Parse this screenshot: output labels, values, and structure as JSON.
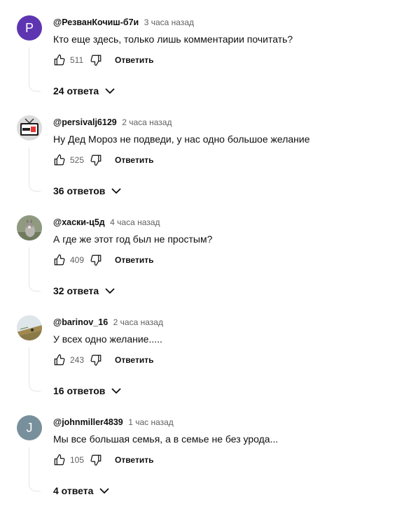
{
  "comments": [
    {
      "avatar": {
        "type": "letter",
        "letter": "P",
        "color": "#5e35b1"
      },
      "author": "@РезванКочиш-б7и",
      "time": "3 часа назад",
      "text": "Кто еще здесь, только лишь комментарии почитать?",
      "likes": "511",
      "reply_label": "Ответить",
      "replies_label": "24 ответа"
    },
    {
      "avatar": {
        "type": "image",
        "icon": "tv-icon"
      },
      "author": "@persivalj6129",
      "time": "2 часа назад",
      "text": "Ну Дед Мороз не подведи, у нас одно большое желание",
      "likes": "525",
      "reply_label": "Ответить",
      "replies_label": "36 ответов"
    },
    {
      "avatar": {
        "type": "image",
        "icon": "husky-icon"
      },
      "author": "@хаски-ц5д",
      "time": "4 часа назад",
      "text": "А где же этот год был не простым?",
      "likes": "409",
      "reply_label": "Ответить",
      "replies_label": "32 ответа"
    },
    {
      "avatar": {
        "type": "image",
        "icon": "field-icon"
      },
      "author": "@barinov_16",
      "time": "2 часа назад",
      "text": "У всех одно желание.....",
      "likes": "243",
      "reply_label": "Ответить",
      "replies_label": "16 ответов"
    },
    {
      "avatar": {
        "type": "letter",
        "letter": "J",
        "color": "#78909c"
      },
      "author": "@johnmiller4839",
      "time": "1 час назад",
      "text": "Мы все большая семья, а в семье не без урода...",
      "likes": "105",
      "reply_label": "Ответить",
      "replies_label": "4 ответа"
    }
  ]
}
